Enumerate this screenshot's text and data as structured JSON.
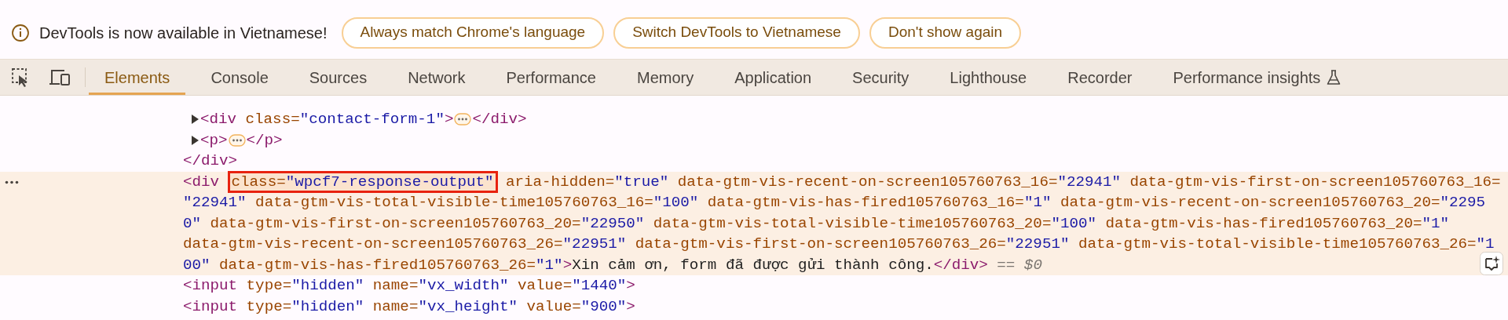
{
  "infobar": {
    "message": "DevTools is now available in Vietnamese!",
    "buttons": [
      "Always match Chrome's language",
      "Switch DevTools to Vietnamese",
      "Don't show again"
    ]
  },
  "toolbar": {
    "tabs": [
      {
        "label": "Elements",
        "selected": true,
        "kind": "plain"
      },
      {
        "label": "Console",
        "selected": false,
        "kind": "plain"
      },
      {
        "label": "Sources",
        "selected": false,
        "kind": "plain"
      },
      {
        "label": "Network",
        "selected": false,
        "kind": "plain"
      },
      {
        "label": "Performance",
        "selected": false,
        "kind": "plain"
      },
      {
        "label": "Memory",
        "selected": false,
        "kind": "plain"
      },
      {
        "label": "Application",
        "selected": false,
        "kind": "plain"
      },
      {
        "label": "Security",
        "selected": false,
        "kind": "plain"
      },
      {
        "label": "Lighthouse",
        "selected": false,
        "kind": "plain"
      },
      {
        "label": "Recorder",
        "selected": false,
        "kind": "plain"
      },
      {
        "label": "Performance insights",
        "selected": false,
        "kind": "experimental"
      }
    ]
  },
  "dom_tree": [
    {
      "kind": "collapsed",
      "selected": false,
      "lines": [
        [
          {
            "kind": "tag",
            "text": "<div"
          },
          {
            "kind": "attr",
            "text": " class="
          },
          {
            "kind": "value",
            "text": "\"contact-form-1\""
          },
          {
            "kind": "tag",
            "text": ">"
          },
          {
            "kind": "ellipsis"
          },
          {
            "kind": "tag",
            "text": "</div>"
          }
        ]
      ]
    },
    {
      "kind": "collapsed",
      "selected": false,
      "lines": [
        [
          {
            "kind": "tag",
            "text": "<p>"
          },
          {
            "kind": "ellipsis"
          },
          {
            "kind": "tag",
            "text": "</p>"
          }
        ]
      ]
    },
    {
      "kind": "leaf",
      "selected": false,
      "lines": [
        [
          {
            "kind": "tag",
            "text": "</div>"
          }
        ]
      ]
    },
    {
      "kind": "leaf",
      "selected": true,
      "lines": [
        [
          {
            "kind": "tag",
            "text": "<div"
          },
          {
            "kind": "boxed",
            "text": "class=\"wpcf7-response-output\""
          },
          {
            "kind": "attr",
            "text": " aria-hidden="
          },
          {
            "kind": "value",
            "text": "\"true\""
          },
          {
            "kind": "attr",
            "text": " data-gtm-vis-recent-on-screen105760763_16="
          },
          {
            "kind": "value",
            "text": "\"22941\""
          },
          {
            "kind": "attr",
            "text": " data-gtm-vis-first-on-screen105760763_16="
          }
        ],
        [
          {
            "kind": "value",
            "text": "\"22941\""
          },
          {
            "kind": "attr",
            "text": " data-gtm-vis-total-visible-time105760763_16="
          },
          {
            "kind": "value",
            "text": "\"100\""
          },
          {
            "kind": "attr",
            "text": " data-gtm-vis-has-fired105760763_16="
          },
          {
            "kind": "value",
            "text": "\"1\""
          },
          {
            "kind": "attr",
            "text": " data-gtm-vis-recent-on-screen105760763_20="
          },
          {
            "kind": "value",
            "text": "\"2295"
          }
        ],
        [
          {
            "kind": "value",
            "text": "0\""
          },
          {
            "kind": "attr",
            "text": " data-gtm-vis-first-on-screen105760763_20="
          },
          {
            "kind": "value",
            "text": "\"22950\""
          },
          {
            "kind": "attr",
            "text": " data-gtm-vis-total-visible-time105760763_20="
          },
          {
            "kind": "value",
            "text": "\"100\""
          },
          {
            "kind": "attr",
            "text": " data-gtm-vis-has-fired105760763_20="
          },
          {
            "kind": "value",
            "text": "\"1\""
          }
        ],
        [
          {
            "kind": "attr",
            "text": "data-gtm-vis-recent-on-screen105760763_26="
          },
          {
            "kind": "value",
            "text": "\"22951\""
          },
          {
            "kind": "attr",
            "text": " data-gtm-vis-first-on-screen105760763_26="
          },
          {
            "kind": "value",
            "text": "\"22951\""
          },
          {
            "kind": "attr",
            "text": " data-gtm-vis-total-visible-time105760763_26="
          },
          {
            "kind": "value",
            "text": "\"1"
          }
        ],
        [
          {
            "kind": "value",
            "text": "00\""
          },
          {
            "kind": "attr",
            "text": " data-gtm-vis-has-fired105760763_26="
          },
          {
            "kind": "value",
            "text": "\"1\""
          },
          {
            "kind": "tag",
            "text": ">"
          },
          {
            "kind": "text",
            "text": "Xin cảm ơn, form đã được gửi thành công."
          },
          {
            "kind": "tag",
            "text": "</div>"
          },
          {
            "kind": "marker",
            "text": " == $0"
          }
        ]
      ]
    },
    {
      "kind": "leaf",
      "selected": false,
      "lines": [
        [
          {
            "kind": "tag",
            "text": "<input"
          },
          {
            "kind": "attr",
            "text": " type="
          },
          {
            "kind": "value",
            "text": "\"hidden\""
          },
          {
            "kind": "attr",
            "text": " name="
          },
          {
            "kind": "value",
            "text": "\"vx_width\""
          },
          {
            "kind": "attr",
            "text": " value="
          },
          {
            "kind": "value",
            "text": "\"1440\""
          },
          {
            "kind": "tag",
            "text": ">"
          }
        ]
      ]
    },
    {
      "kind": "leaf",
      "selected": false,
      "lines": [
        [
          {
            "kind": "tag",
            "text": "<input"
          },
          {
            "kind": "attr",
            "text": " type="
          },
          {
            "kind": "value",
            "text": "\"hidden\""
          },
          {
            "kind": "attr",
            "text": " name="
          },
          {
            "kind": "value",
            "text": "\"vx_height\""
          },
          {
            "kind": "attr",
            "text": " value="
          },
          {
            "kind": "value",
            "text": "\"900\""
          },
          {
            "kind": "tag",
            "text": ">"
          }
        ]
      ]
    }
  ]
}
